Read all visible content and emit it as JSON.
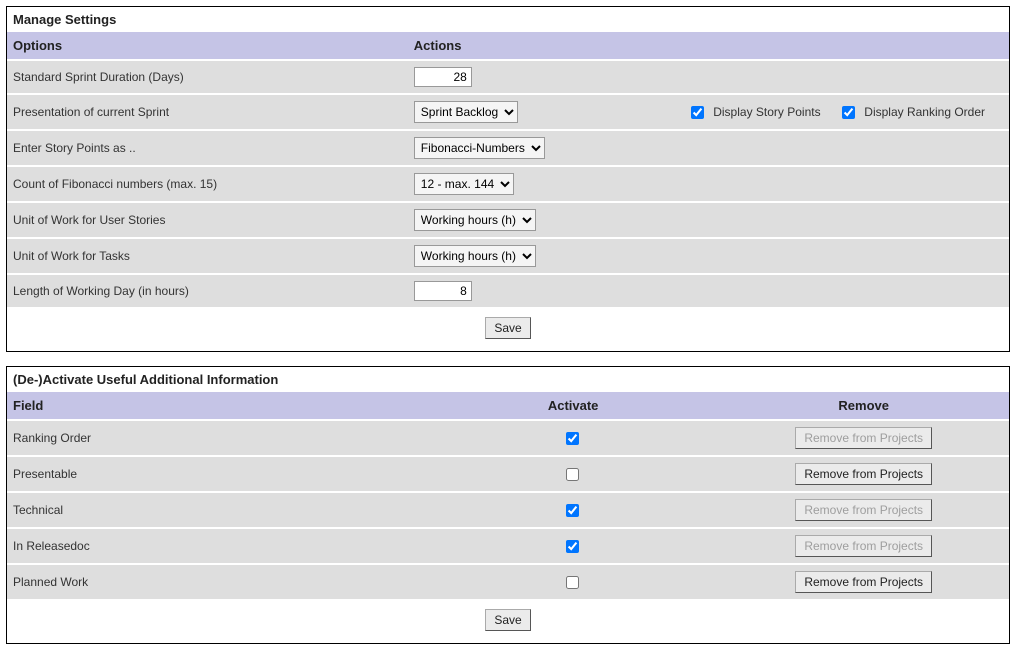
{
  "panels": {
    "settings": {
      "title": "Manage Settings",
      "headers": {
        "options": "Options",
        "actions": "Actions"
      },
      "rows": {
        "sprint_duration": {
          "label": "Standard Sprint Duration (Days)",
          "value": "28"
        },
        "presentation": {
          "label": "Presentation of current Sprint",
          "value": "Sprint Backlog",
          "display_story_points_label": "Display Story Points",
          "display_story_points_checked": true,
          "display_ranking_order_label": "Display Ranking Order",
          "display_ranking_order_checked": true
        },
        "story_points_as": {
          "label": "Enter Story Points as ..",
          "value": "Fibonacci-Numbers"
        },
        "fib_count": {
          "label": "Count of Fibonacci numbers (max. 15)",
          "value": "12 - max. 144"
        },
        "unit_stories": {
          "label": "Unit of Work for User Stories",
          "value": "Working hours (h)"
        },
        "unit_tasks": {
          "label": "Unit of Work for Tasks",
          "value": "Working hours (h)"
        },
        "day_length": {
          "label": "Length of Working Day (in hours)",
          "value": "8"
        }
      },
      "save_label": "Save"
    },
    "fields": {
      "title": "(De-)Activate Useful Additional Information",
      "headers": {
        "field": "Field",
        "activate": "Activate",
        "remove": "Remove"
      },
      "remove_button_label": "Remove from Projects",
      "rows": [
        {
          "label": "Ranking Order",
          "activated": true,
          "remove_enabled": false
        },
        {
          "label": "Presentable",
          "activated": false,
          "remove_enabled": true
        },
        {
          "label": "Technical",
          "activated": true,
          "remove_enabled": false
        },
        {
          "label": "In Releasedoc",
          "activated": true,
          "remove_enabled": false
        },
        {
          "label": "Planned Work",
          "activated": false,
          "remove_enabled": true
        }
      ],
      "save_label": "Save"
    }
  }
}
